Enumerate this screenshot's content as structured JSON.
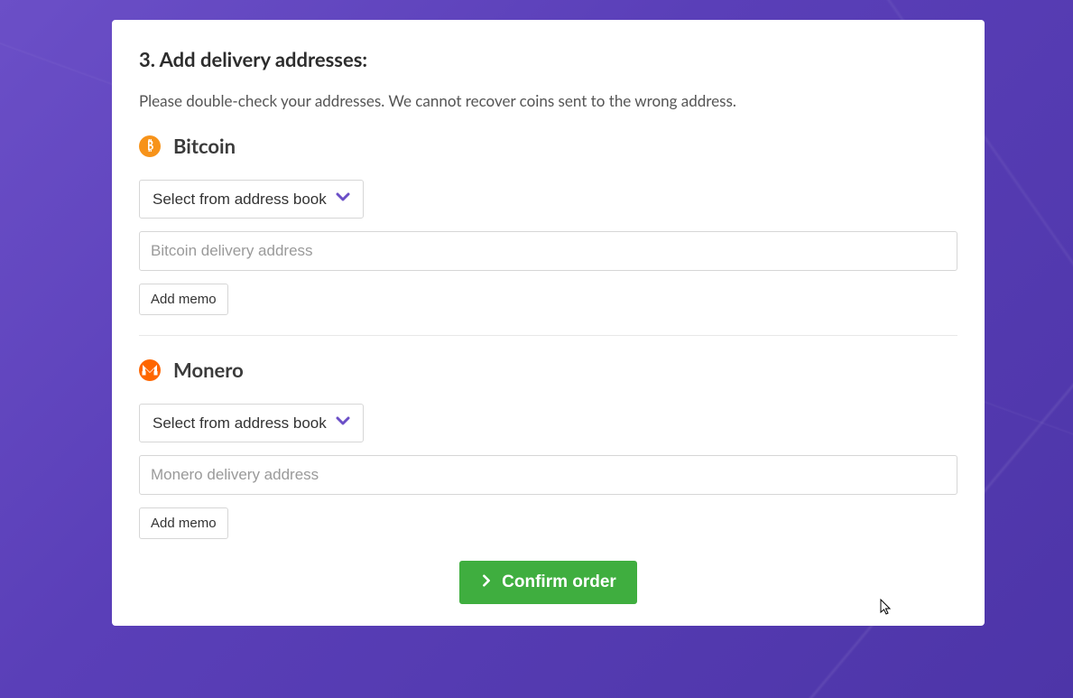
{
  "heading": "3. Add delivery addresses:",
  "subtext": "Please double-check your addresses. We cannot recover coins sent to the wrong address.",
  "colors": {
    "accent_purple": "#6b4fc7",
    "confirm_green": "#3fae3f",
    "btc_orange": "#f7931a",
    "xmr_orange": "#ff6600",
    "chevron_purple": "#6b4fc7"
  },
  "coins": {
    "btc": {
      "name": "Bitcoin",
      "select_label": "Select from address book",
      "placeholder": "Bitcoin delivery address",
      "memo_label": "Add memo"
    },
    "xmr": {
      "name": "Monero",
      "select_label": "Select from address book",
      "placeholder": "Monero delivery address",
      "memo_label": "Add memo"
    }
  },
  "confirm_label": "Confirm order"
}
